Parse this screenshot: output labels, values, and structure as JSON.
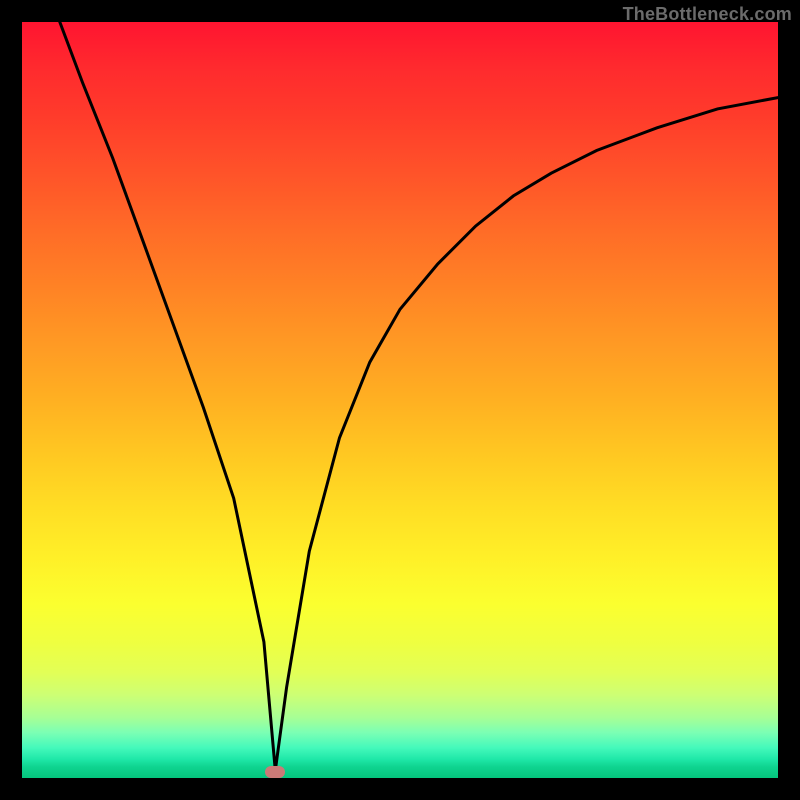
{
  "watermark": "TheBottleneck.com",
  "chart_data": {
    "type": "line",
    "title": "",
    "xlabel": "",
    "ylabel": "",
    "xlim": [
      0,
      100
    ],
    "ylim": [
      0,
      100
    ],
    "series": [
      {
        "name": "curve",
        "x": [
          5,
          8,
          12,
          16,
          20,
          24,
          28,
          32,
          33.5,
          35,
          38,
          42,
          46,
          50,
          55,
          60,
          65,
          70,
          76,
          84,
          92,
          100
        ],
        "y": [
          100,
          92,
          82,
          71,
          60,
          49,
          37,
          18,
          1,
          12,
          30,
          45,
          55,
          62,
          68,
          73,
          77,
          80,
          83,
          86,
          88.5,
          90
        ]
      }
    ],
    "marker": {
      "x": 33.5,
      "y": 0.8,
      "color": "#cb7a77"
    }
  },
  "colors": {
    "gradient_top": "#ff1430",
    "gradient_bottom": "#05c57d",
    "curve": "#000000",
    "frame": "#000000"
  }
}
